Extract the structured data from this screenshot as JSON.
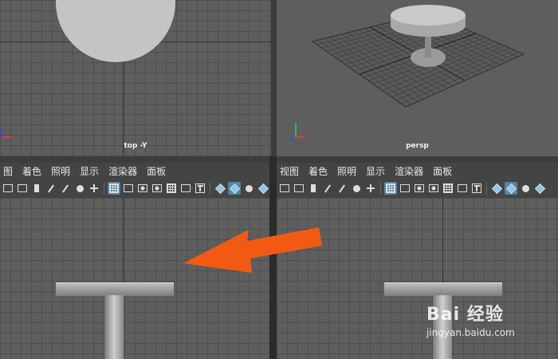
{
  "viewports": {
    "top_left": {
      "label": "top -Y"
    },
    "top_right": {
      "label": "persp"
    },
    "bottom_left": {
      "menus": [
        "图",
        "着色",
        "照明",
        "显示",
        "渲染器",
        "面板"
      ]
    },
    "bottom_right": {
      "menus": [
        "视图",
        "着色",
        "照明",
        "显示",
        "渲染器",
        "面板"
      ]
    }
  },
  "toolbar_icons": [
    "camera-select-icon",
    "camera-attributes-icon",
    "bookmark-icon",
    "pencil-icon",
    "grease-pencil-icon",
    "pan-zoom-icon",
    "2d-pan-icon",
    "grid-icon",
    "film-gate-icon",
    "resolution-gate-icon",
    "gate-mask-icon",
    "field-chart-icon",
    "safe-action-icon",
    "safe-title-icon",
    "wireframe-icon",
    "smooth-shade-icon",
    "default-material-icon",
    "shaded-wireframe-icon"
  ],
  "colors": {
    "viewport_bg": "#5e5e5e",
    "arrow": "#f25a14",
    "active_button": "#5285a6"
  },
  "watermark": {
    "brand": "Bai 经验",
    "url": "jingyan.baidu.com"
  }
}
